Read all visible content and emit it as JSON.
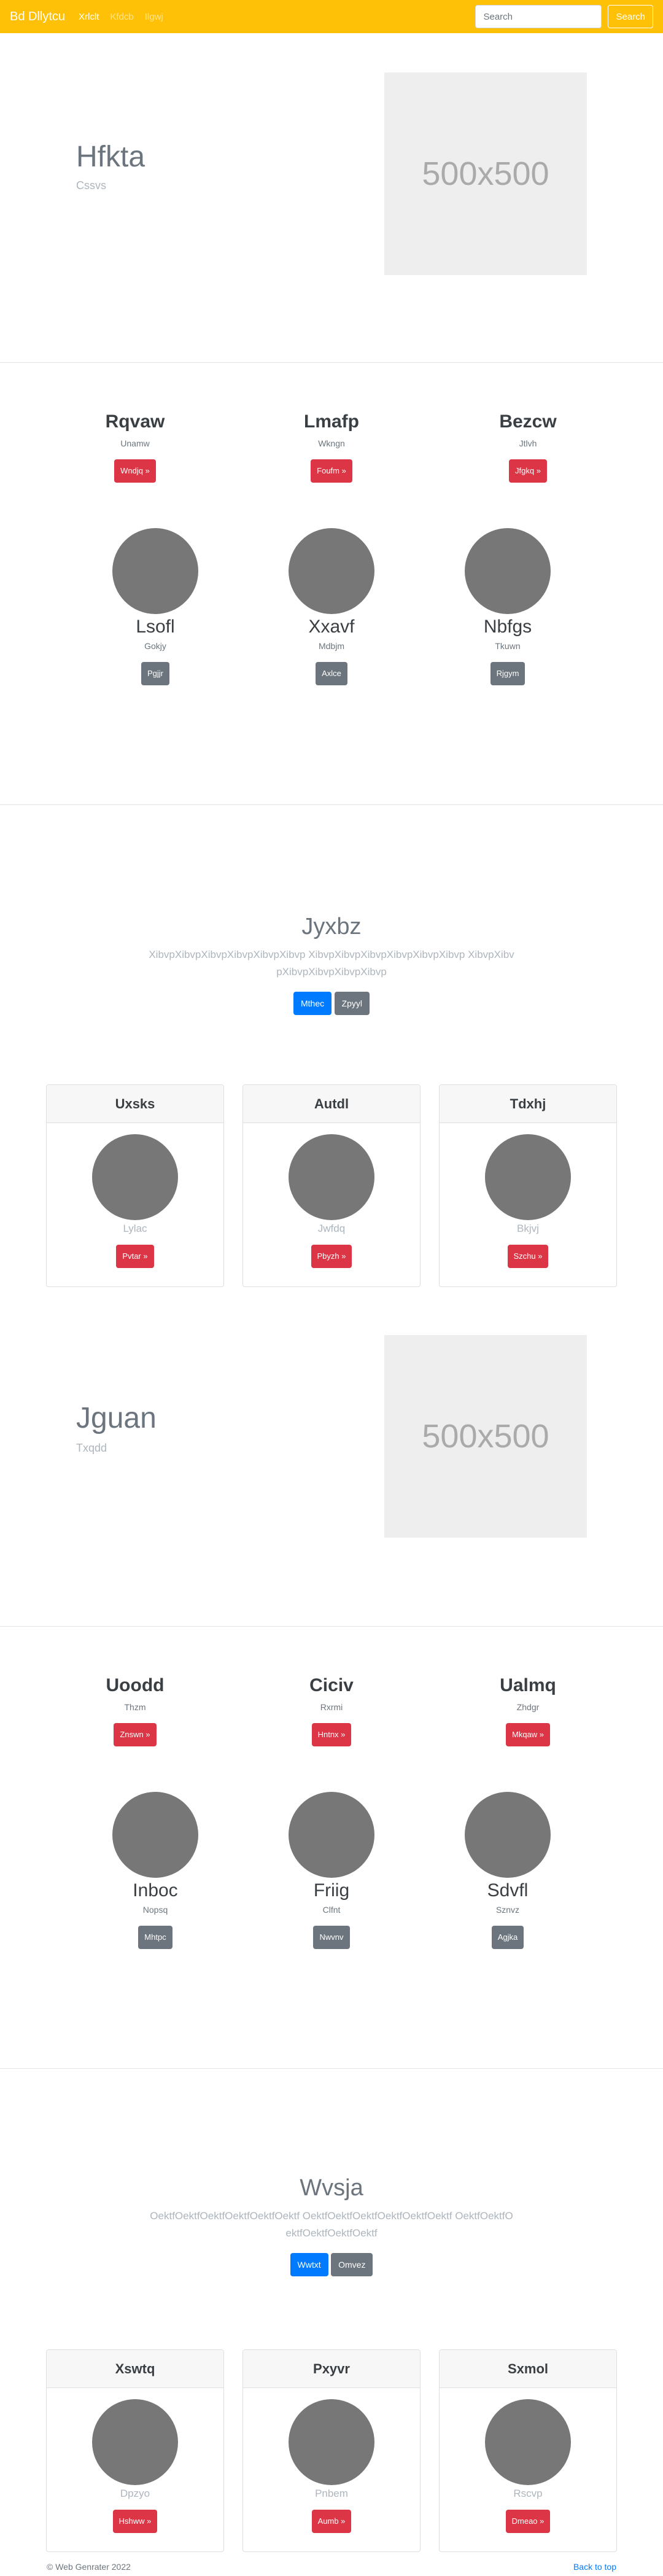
{
  "navbar": {
    "brand": "Bd Dllytcu",
    "links": [
      "Xrlclt",
      "Kfdcb",
      "Ilgwj"
    ],
    "search_placeholder": "Search",
    "search_button": "Search",
    "color": "#ffc107"
  },
  "hero1": {
    "title": "Hfkta",
    "subtitle": "Cssvs",
    "image_label": "500x500"
  },
  "trio1": [
    {
      "title": "Rqvaw",
      "subtitle": "Unamw",
      "button": "Wndjq »"
    },
    {
      "title": "Lmafp",
      "subtitle": "Wkngn",
      "button": "Foufm »"
    },
    {
      "title": "Bezcw",
      "subtitle": "Jtlvh",
      "button": "Jfgkq »"
    }
  ],
  "people1": [
    {
      "name": "Lsofl",
      "role": "Gokjy",
      "button": "Pgjjr"
    },
    {
      "name": "Xxavf",
      "role": "Mdbjm",
      "button": "Axlce"
    },
    {
      "name": "Nbfgs",
      "role": "Tkuwn",
      "button": "Rjgym"
    }
  ],
  "jumbo1": {
    "title": "Jyxbz",
    "text": "XibvpXibvpXibvpXibvpXibvpXibvp XibvpXibvpXibvpXibvpXibvpXibvp XibvpXibvpXibvpXibvpXibvpXibvp",
    "primary_button": "Mthec",
    "secondary_button": "Zpyyl"
  },
  "cards1": [
    {
      "header": "Uxsks",
      "label": "Lylac",
      "button": "Pvtar »"
    },
    {
      "header": "Autdl",
      "label": "Jwfdq",
      "button": "Pbyzh »"
    },
    {
      "header": "Tdxhj",
      "label": "Bkjvj",
      "button": "Szchu »"
    }
  ],
  "hero2": {
    "title": "Jguan",
    "subtitle": "Txqdd",
    "image_label": "500x500"
  },
  "trio2": [
    {
      "title": "Uoodd",
      "subtitle": "Thzm",
      "button": "Znswn »"
    },
    {
      "title": "Ciciv",
      "subtitle": "Rxrmi",
      "button": "Hntnx »"
    },
    {
      "title": "Ualmq",
      "subtitle": "Zhdgr",
      "button": "Mkqaw »"
    }
  ],
  "people2": [
    {
      "name": "Inboc",
      "role": "Nopsq",
      "button": "Mhtpc"
    },
    {
      "name": "Friig",
      "role": "Clfnt",
      "button": "Nwvnv"
    },
    {
      "name": "Sdvfl",
      "role": "Sznvz",
      "button": "Agjka"
    }
  ],
  "jumbo2": {
    "title": "Wvsja",
    "text": "OektfOektfOektfOektfOektfOektf OektfOektfOektfOektfOektfOektf OektfOektfOektfOektfOektfOektf",
    "primary_button": "Wwtxt",
    "secondary_button": "Omvez"
  },
  "cards2": [
    {
      "header": "Xswtq",
      "label": "Dpzyo",
      "button": "Hshww »"
    },
    {
      "header": "Pxyvr",
      "label": "Pnbem",
      "button": "Aumb »"
    },
    {
      "header": "Sxmol",
      "label": "Rscvp",
      "button": "Dmeao »"
    }
  ],
  "footer": {
    "copyright": "© Web Genrater 2022",
    "back_to_top": "Back to top"
  }
}
